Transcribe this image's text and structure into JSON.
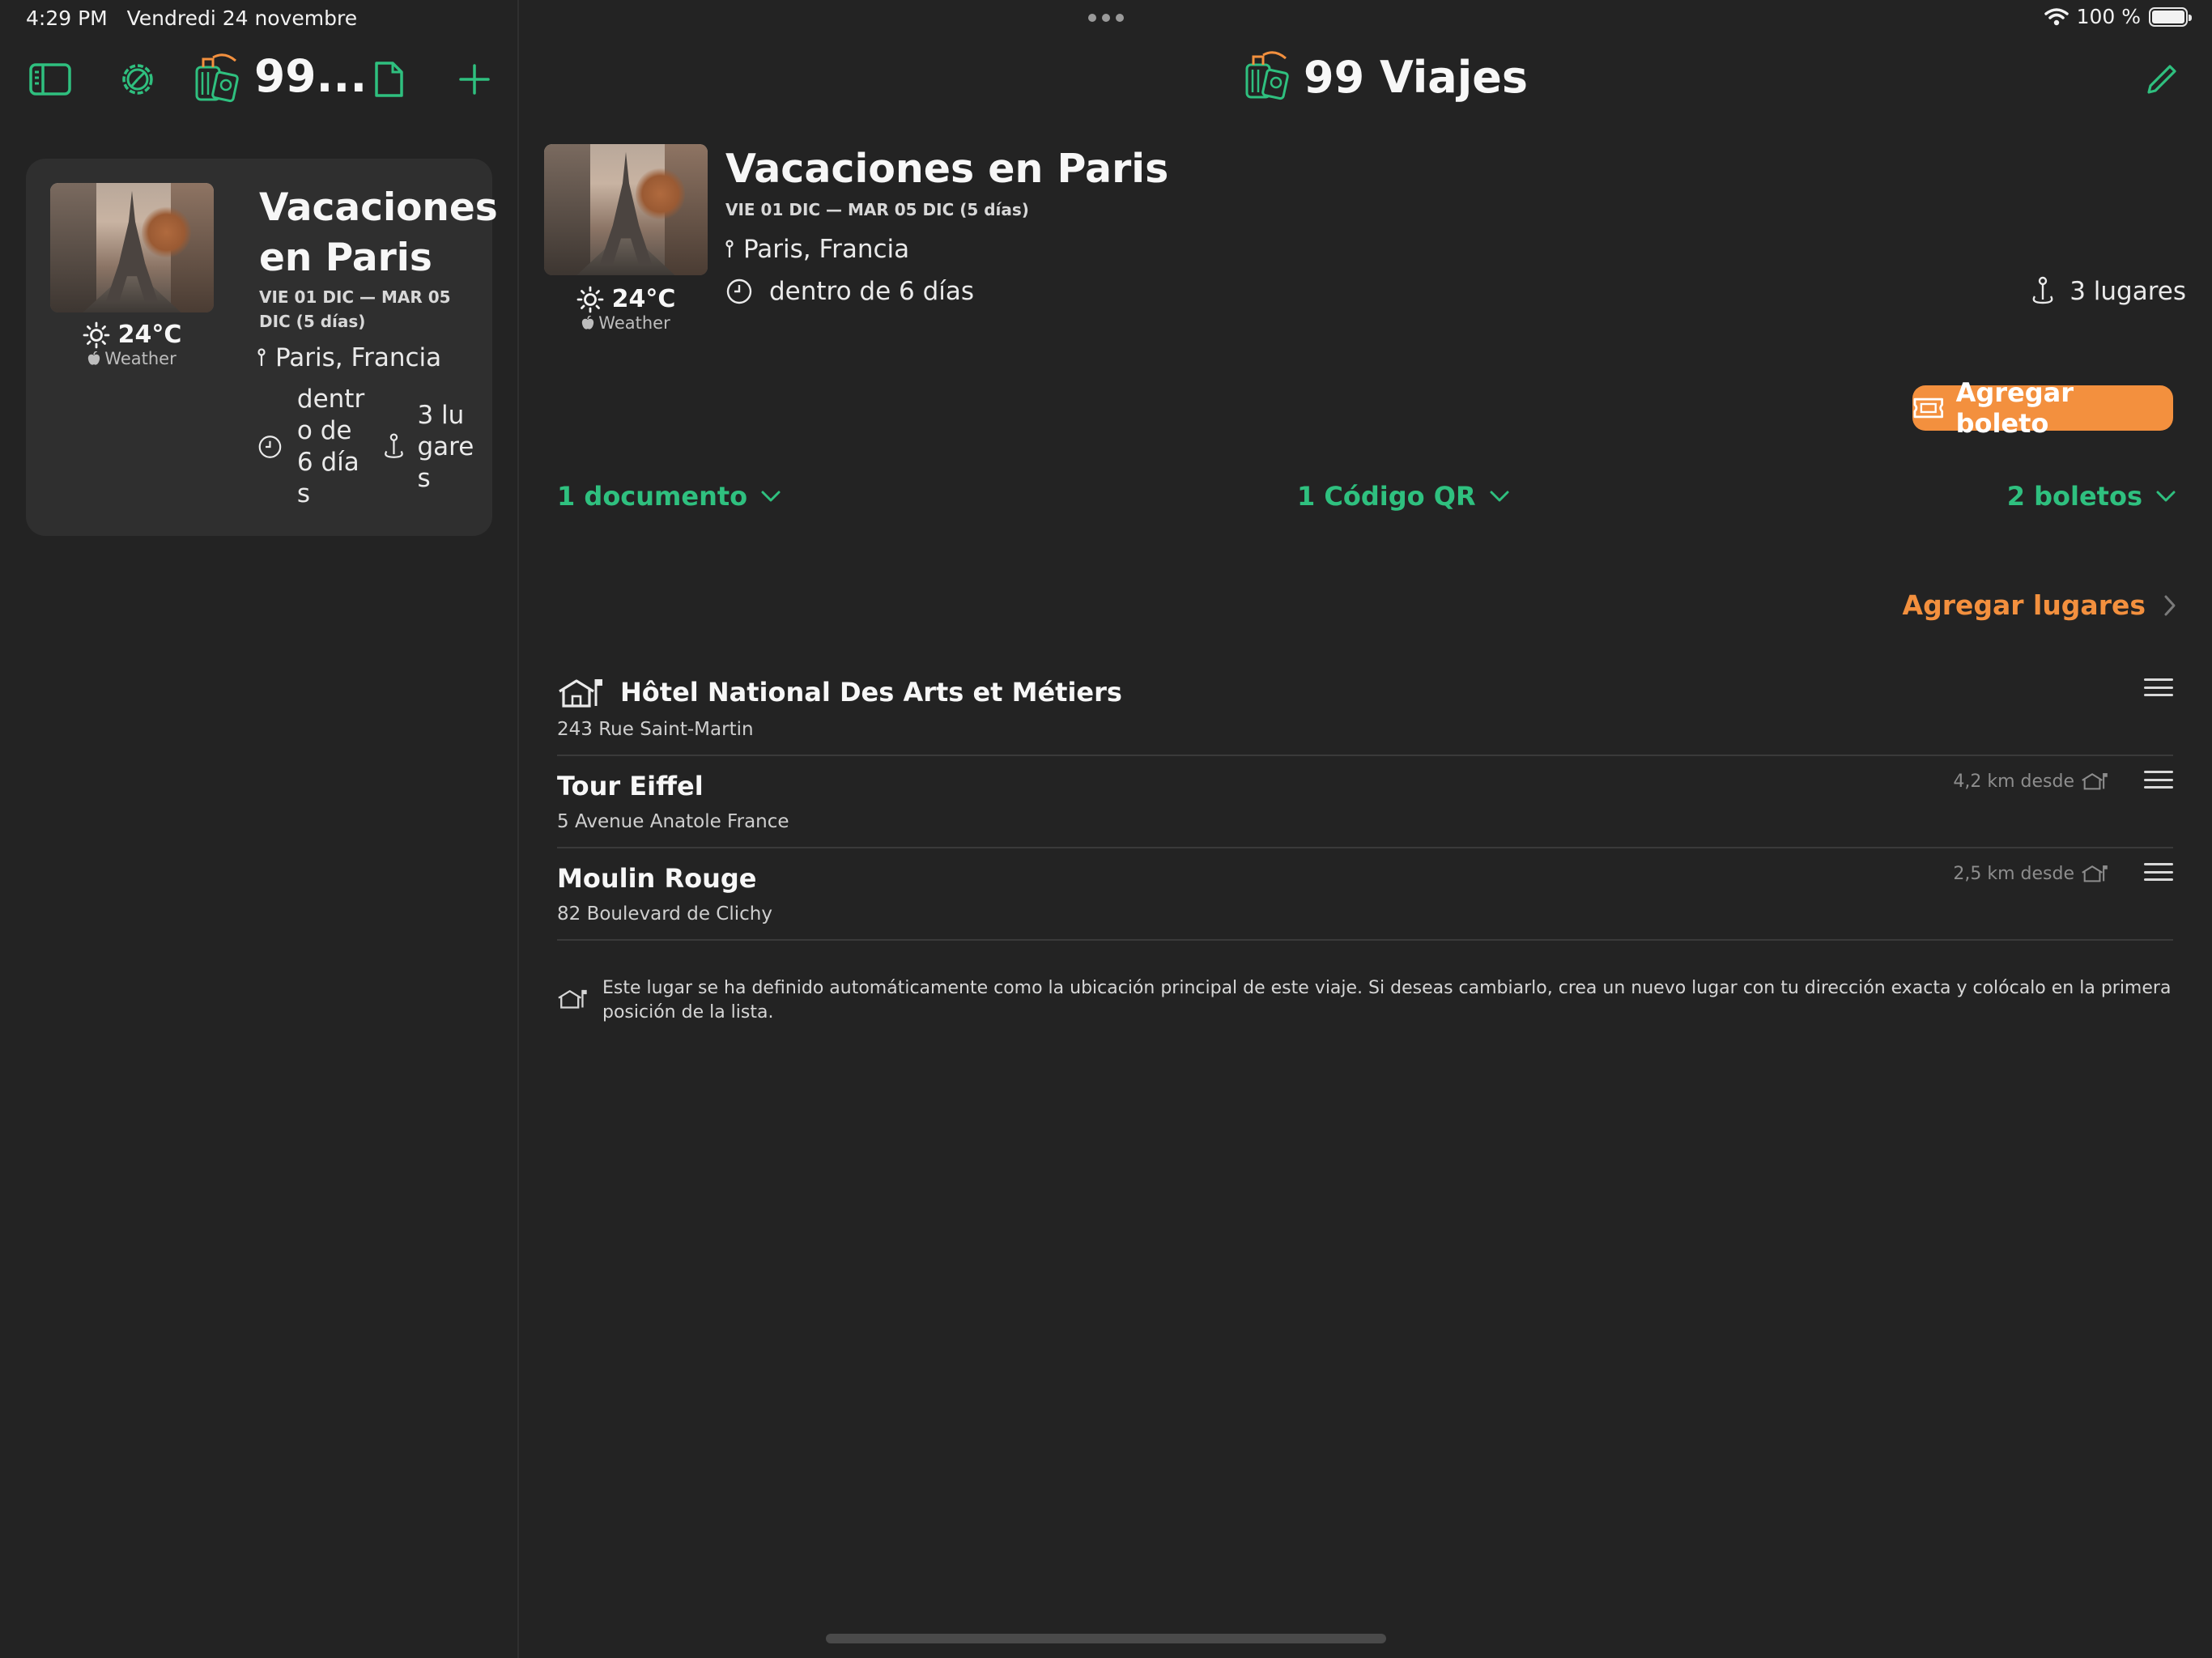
{
  "status_bar": {
    "time": "4:29 PM",
    "date": "Vendredi 24 novembre",
    "battery": "100 %",
    "battery_level": 1.0
  },
  "sidebar": {
    "title": "99...",
    "trip_card": {
      "title": "Vacaciones en Paris",
      "dates": "VIE 01 DIC — MAR 05 DIC  (5 días)",
      "temperature": "24°C",
      "weather_source": "Weather",
      "location": "Paris, Francia",
      "countdown": "dentro de 6 días",
      "places": "3 lugares"
    }
  },
  "main": {
    "title": "99 Viajes",
    "trip": {
      "title": "Vacaciones en Paris",
      "dates": "VIE 01 DIC — MAR 05 DIC  (5 días)",
      "temperature": "24°C",
      "weather_source": "Weather",
      "location": "Paris, Francia",
      "countdown": "dentro de 6 días",
      "places_count": "3 lugares"
    },
    "add_ticket_label": "Agregar boleto",
    "expanders": {
      "documents": "1 documento",
      "qr_codes": "1 Código QR",
      "tickets": "2 boletos"
    },
    "add_places_label": "Agregar lugares",
    "places": [
      {
        "name": "Hôtel National Des Arts et Métiers",
        "address": "243 Rue Saint-Martin",
        "distance": ""
      },
      {
        "name": "Tour Eiffel",
        "address": "5 Avenue Anatole France",
        "distance": "4,2 km desde"
      },
      {
        "name": "Moulin Rouge",
        "address": "82 Boulevard de Clichy",
        "distance": "2,5 km desde"
      }
    ],
    "footnote": "Este lugar se ha definido automáticamente como la ubicación principal de este viaje. Si deseas cambiarlo, crea un nuevo lugar con tu dirección exacta y colócalo en la primera posición de la lista."
  },
  "colors": {
    "background": "#232323",
    "card": "#2f2f2f",
    "accent_green": "#2fc07f",
    "accent_orange": "#f3903e"
  },
  "icons": [
    "sidebar-toggle-icon",
    "settings-gear-icon",
    "app-logo-icon",
    "document-icon",
    "plus-icon",
    "pencil-icon",
    "sun-icon",
    "apple-icon",
    "pin-icon",
    "clock-icon",
    "place-marker-icon",
    "ticket-icon",
    "chevron-down-icon",
    "chevron-right-icon",
    "home-icon",
    "drag-handle-icon",
    "wifi-icon",
    "battery-icon"
  ]
}
